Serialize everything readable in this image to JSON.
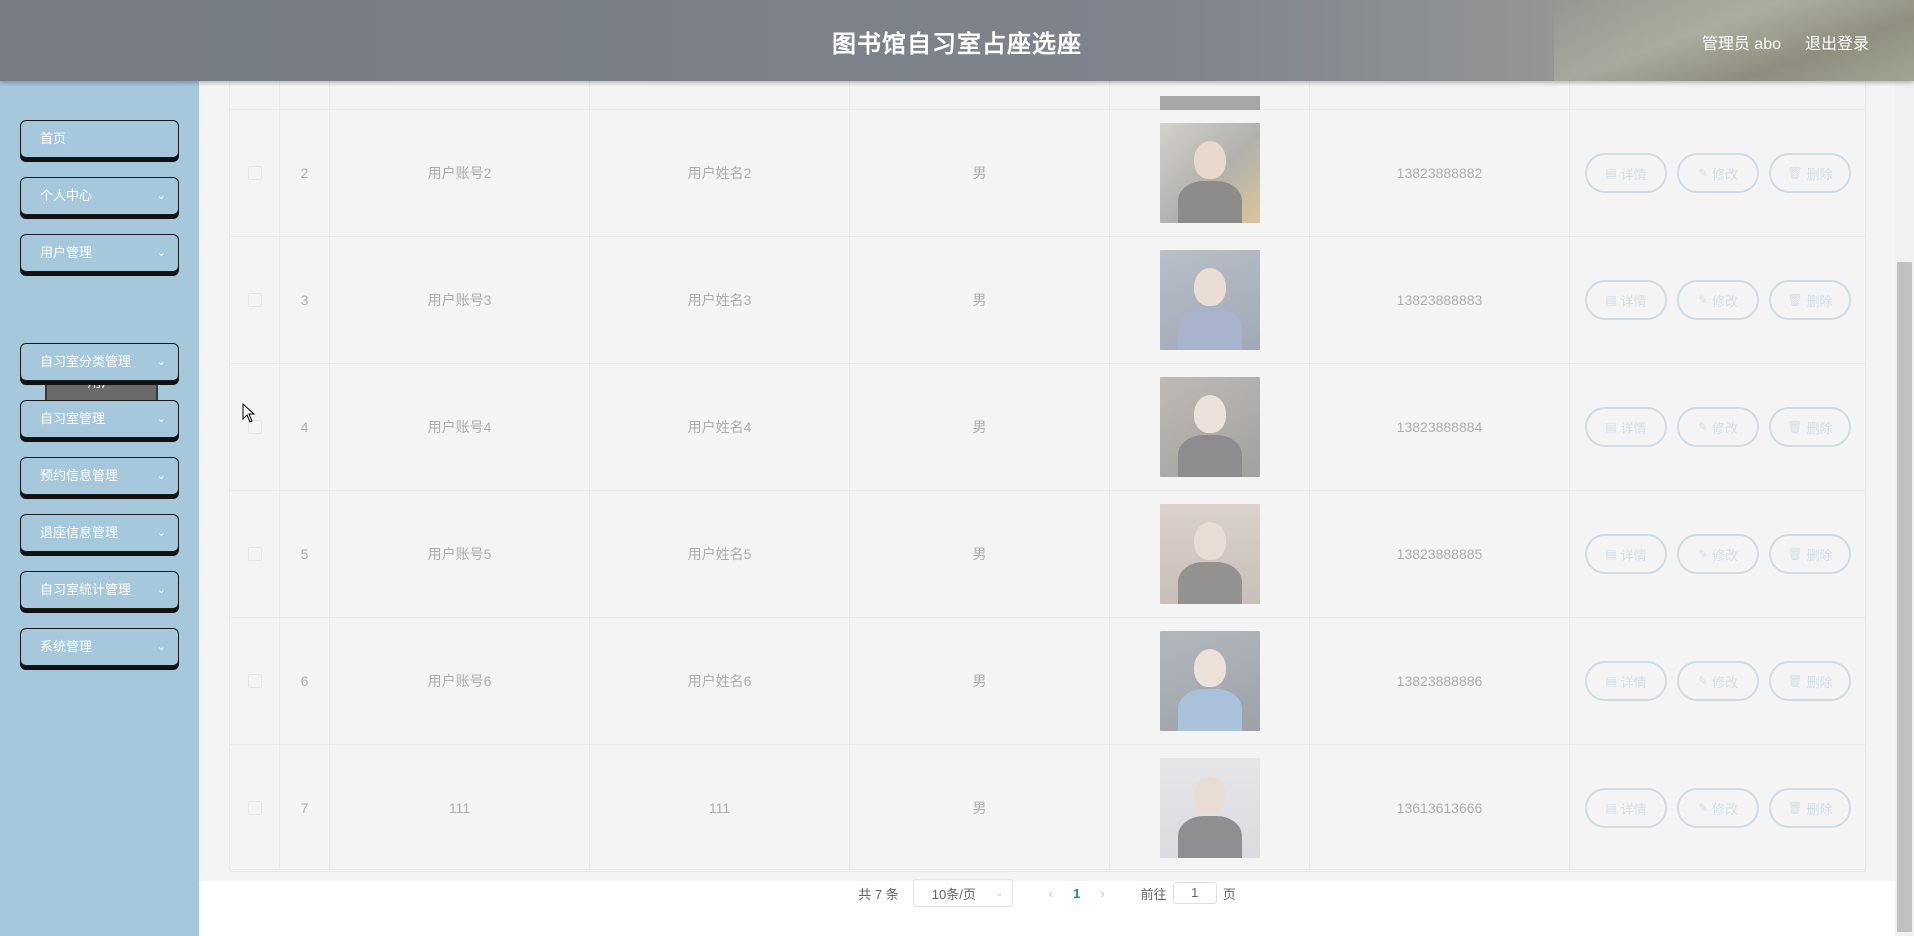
{
  "header": {
    "title": "图书馆自习室占座选座",
    "user_label": "管理员 abo",
    "logout_label": "退出登录"
  },
  "sidebar": {
    "items": [
      {
        "label": "首页",
        "chevron": ""
      },
      {
        "label": "个人中心",
        "chevron": "⌄"
      },
      {
        "label": "用户管理",
        "chevron": "⌄"
      },
      {
        "label": "自习室分类管理",
        "chevron": "⌄"
      },
      {
        "label": "自习室管理",
        "chevron": "⌄"
      },
      {
        "label": "预约信息管理",
        "chevron": "⌄"
      },
      {
        "label": "退座信息管理",
        "chevron": "⌄"
      },
      {
        "label": "自习室统计管理",
        "chevron": "⌄"
      },
      {
        "label": "系统管理",
        "chevron": "⌄"
      }
    ],
    "active_sub_item": "用户"
  },
  "table": {
    "rows": [
      {
        "index": "2",
        "account": "用户账号2",
        "name": "用户姓名2",
        "sex": "男",
        "phone": "13823888882"
      },
      {
        "index": "3",
        "account": "用户账号3",
        "name": "用户姓名3",
        "sex": "男",
        "phone": "13823888883"
      },
      {
        "index": "4",
        "account": "用户账号4",
        "name": "用户姓名4",
        "sex": "男",
        "phone": "13823888884"
      },
      {
        "index": "5",
        "account": "用户账号5",
        "name": "用户姓名5",
        "sex": "男",
        "phone": "13823888885"
      },
      {
        "index": "6",
        "account": "用户账号6",
        "name": "用户姓名6",
        "sex": "男",
        "phone": "13823888886"
      },
      {
        "index": "7",
        "account": "111",
        "name": "111",
        "sex": "男",
        "phone": "13613613666"
      }
    ],
    "actions": {
      "detail": "详情",
      "edit": "修改",
      "delete": "删除"
    }
  },
  "pagination": {
    "total": "共 7 条",
    "page_size": "10条/页",
    "current_page": "1",
    "goto_label": "前往",
    "goto_value": "1",
    "page_suffix": "页"
  },
  "colors": {
    "sidebar_bg": "#a5c8dd",
    "button_border": "#a7c7dd",
    "active_page": "#1f8f7f"
  }
}
